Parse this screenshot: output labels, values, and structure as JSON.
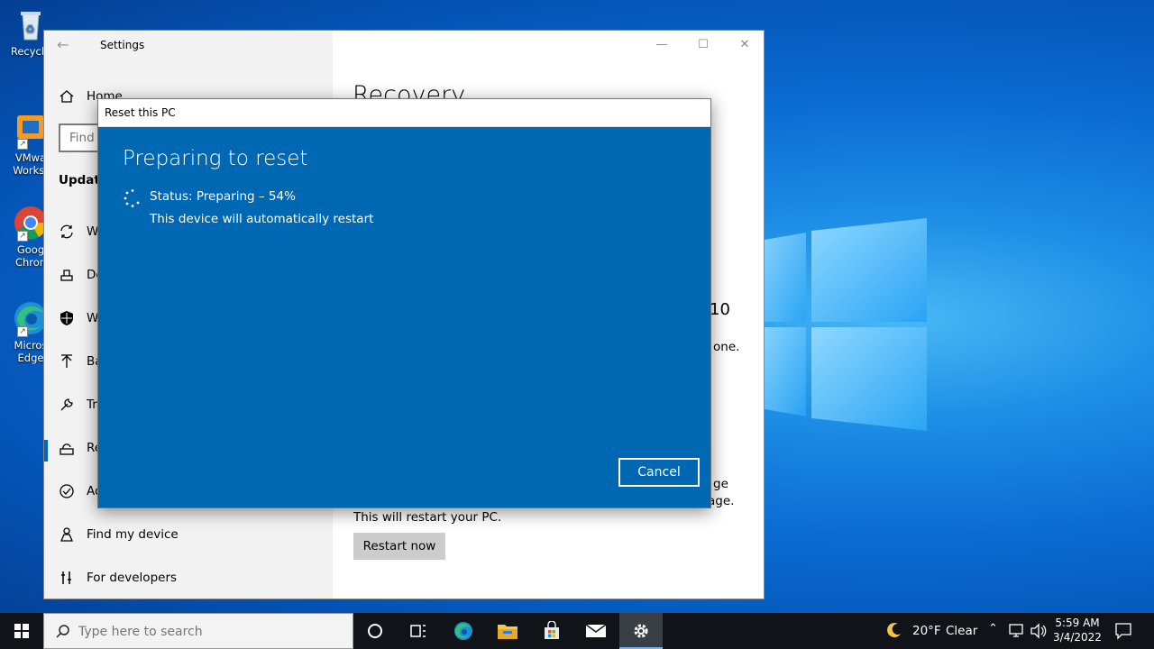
{
  "desktop": {
    "icons": [
      {
        "label": "Recycle",
        "icon": "recycle-bin-icon"
      },
      {
        "label": "VMwa Workst",
        "line1": "VMwa",
        "line2": "Workst",
        "icon": "vmware-icon"
      },
      {
        "label": "Goog Chrom",
        "line1": "Goog",
        "line2": "Chron",
        "icon": "chrome-icon"
      },
      {
        "label": "Micros Edge",
        "line1": "Micros",
        "line2": "Edge",
        "icon": "edge-icon"
      }
    ]
  },
  "settings": {
    "title": "Settings",
    "home_label": "Home",
    "find_placeholder": "Find a setting",
    "section_title": "Update",
    "nav_items": [
      {
        "label": "W",
        "icon": "sync-icon"
      },
      {
        "label": "De",
        "icon": "delivery-icon"
      },
      {
        "label": "W",
        "icon": "shield-icon"
      },
      {
        "label": "Ba",
        "icon": "backup-arrow-icon"
      },
      {
        "label": "Tr",
        "icon": "wrench-icon"
      },
      {
        "label": "Re",
        "icon": "recovery-icon"
      },
      {
        "label": "Ac",
        "icon": "check-circle-icon"
      },
      {
        "label": "Find my device",
        "icon": "person-pin-icon"
      },
      {
        "label": "For developers",
        "icon": "developer-tools-icon"
      }
    ],
    "right": {
      "title": "Recovery",
      "fragment_10": "10",
      "fragment_one": "one.",
      "fragment_ge": "ge",
      "fragment_age": "age.",
      "restart_text": "This will restart your PC.",
      "restart_button": "Restart now"
    }
  },
  "dialog": {
    "title": "Reset this PC",
    "heading": "Preparing to reset",
    "status": "Status: Preparing – 54%",
    "progress_percent": 54,
    "subtext": "This device will automatically restart",
    "cancel_label": "Cancel"
  },
  "taskbar": {
    "search_placeholder": "Type here to search",
    "weather_temp": "20°F",
    "weather_desc": "Clear",
    "time": "5:59 AM",
    "date": "3/4/2022"
  },
  "colors": {
    "dialog_blue": "#0067b3",
    "taskbar": "#101418",
    "accent": "#0067c0"
  }
}
